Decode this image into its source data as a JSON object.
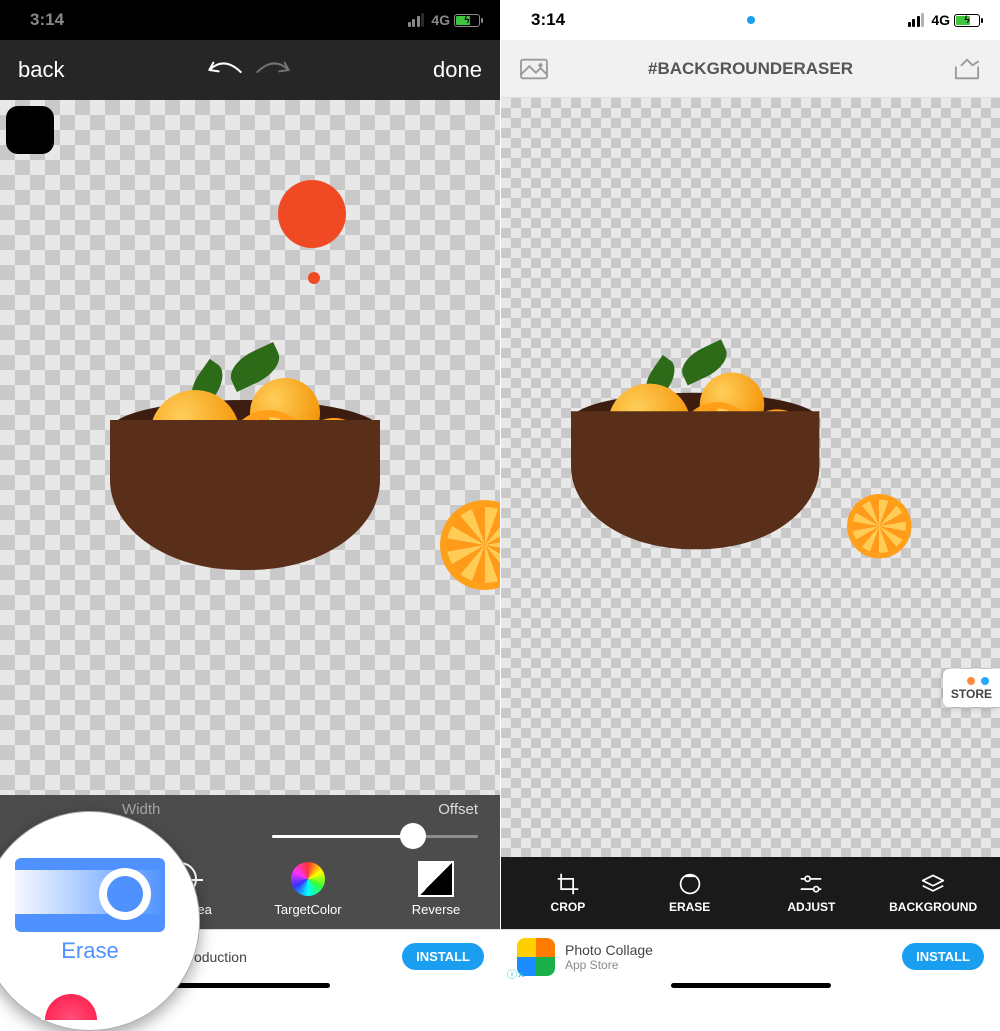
{
  "status": {
    "time": "3:14",
    "network": "4G"
  },
  "left": {
    "nav": {
      "back": "back",
      "done": "done"
    },
    "sliders": {
      "width_label": "Width",
      "offset_label": "Offset"
    },
    "tools": {
      "target_area": "TargetArea",
      "target_color": "TargetColor",
      "reverse": "Reverse"
    },
    "bubble": {
      "erase": "Erase"
    },
    "ad": {
      "text": "...auty Free avatar production",
      "cta": "INSTALL"
    }
  },
  "right": {
    "title": "#BACKGROUNDERASER",
    "store_badge": "STORE",
    "tools": {
      "crop": "CROP",
      "erase": "ERASE",
      "adjust": "ADJUST",
      "background": "BACKGROUND"
    },
    "ad": {
      "title": "Photo Collage",
      "sub": "App Store",
      "cta": "INSTALL"
    }
  }
}
